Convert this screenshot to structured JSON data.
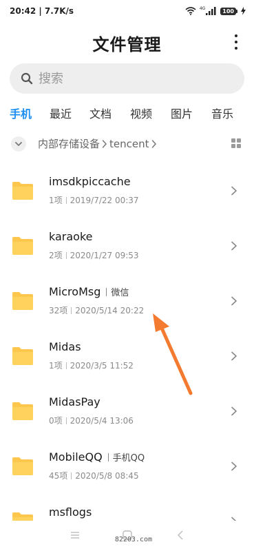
{
  "status_bar": {
    "time_speed": "20:42 | 7.7K/s",
    "network": "4G",
    "battery": "100"
  },
  "header": {
    "title": "文件管理"
  },
  "search": {
    "placeholder": "搜索"
  },
  "tabs": [
    {
      "label": "手机",
      "active": true
    },
    {
      "label": "最近",
      "active": false
    },
    {
      "label": "文档",
      "active": false
    },
    {
      "label": "视频",
      "active": false
    },
    {
      "label": "图片",
      "active": false
    },
    {
      "label": "音乐",
      "active": false
    }
  ],
  "breadcrumb": {
    "items": [
      "内部存储设备",
      "tencent"
    ]
  },
  "folders": [
    {
      "name": "imsdkpiccache",
      "tag": "",
      "count": "1项",
      "date": "2019/7/22 00:37"
    },
    {
      "name": "karaoke",
      "tag": "",
      "count": "2项",
      "date": "2020/1/27 09:53"
    },
    {
      "name": "MicroMsg",
      "tag": "微信",
      "count": "32项",
      "date": "2020/5/14 20:22"
    },
    {
      "name": "Midas",
      "tag": "",
      "count": "1项",
      "date": "2020/3/5 11:52"
    },
    {
      "name": "MidasPay",
      "tag": "",
      "count": "0项",
      "date": "2020/5/4 13:06"
    },
    {
      "name": "MobileQQ",
      "tag": "手机QQ",
      "count": "45项",
      "date": "2020/5/8 08:45"
    },
    {
      "name": "msflogs",
      "tag": "",
      "count": "",
      "date": ""
    }
  ],
  "watermark": "82203.com",
  "colors": {
    "accent": "#1f8ef1",
    "folder": "#fdc74d",
    "annotation_arrow": "#f37a2e"
  }
}
